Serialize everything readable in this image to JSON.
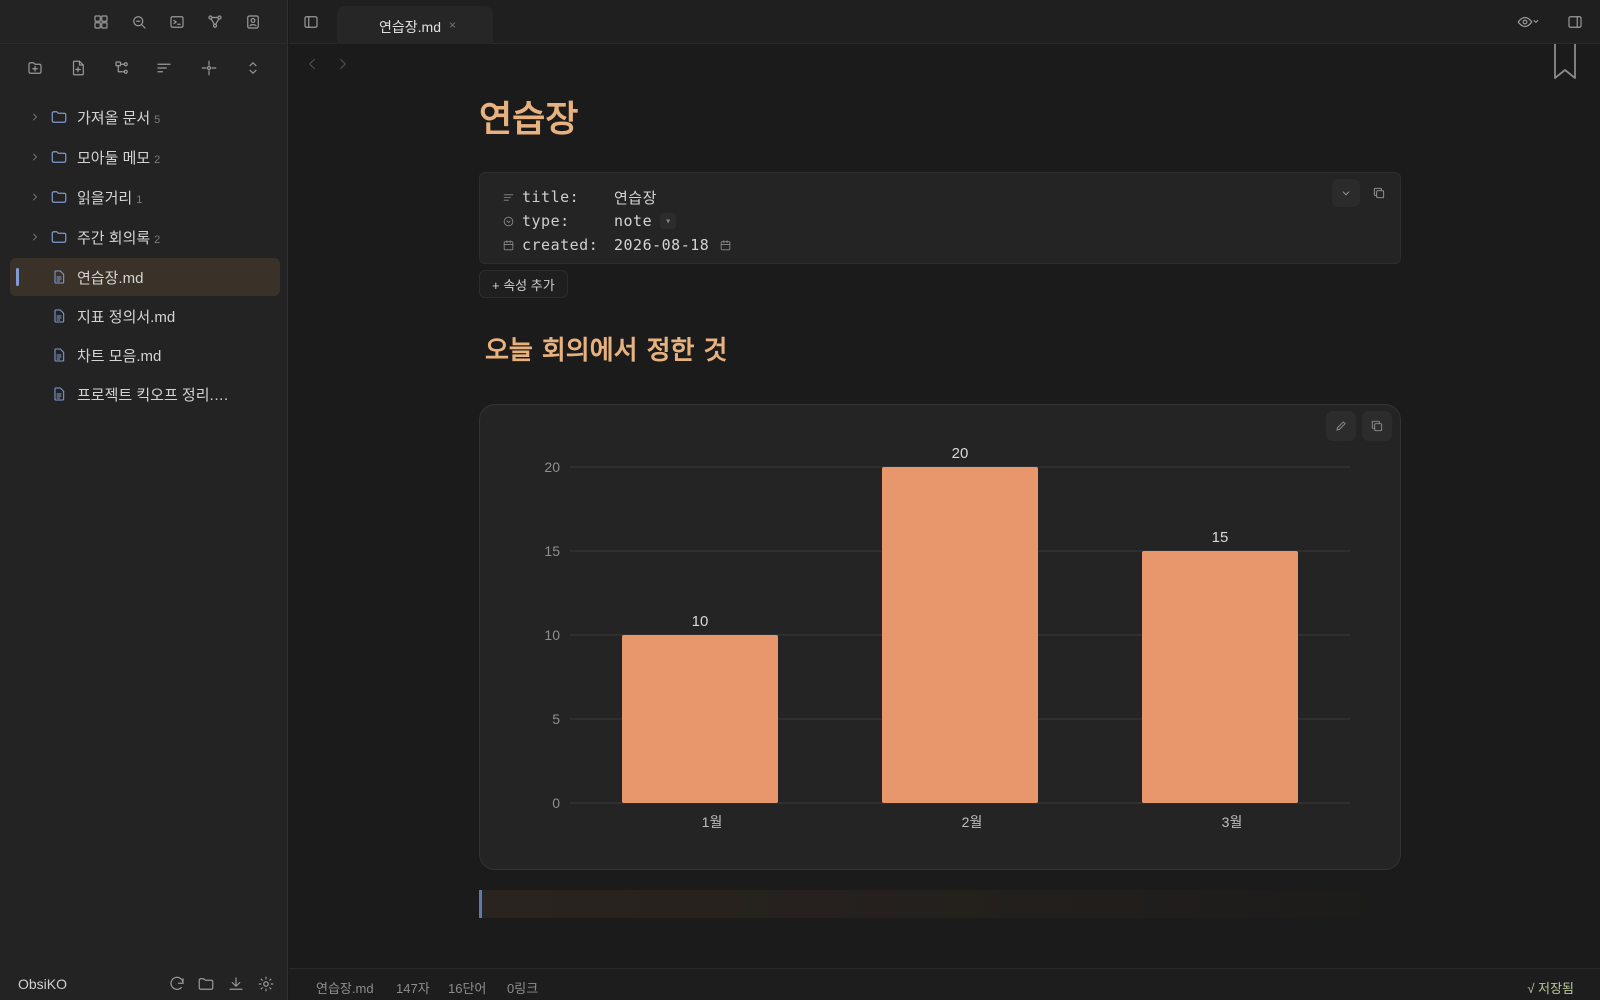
{
  "sidebar": {
    "tree": [
      {
        "type": "folder",
        "label": "가져올 문서",
        "count": "5"
      },
      {
        "type": "folder",
        "label": "모아둘 메모",
        "count": "2"
      },
      {
        "type": "folder",
        "label": "읽을거리",
        "count": "1"
      },
      {
        "type": "folder",
        "label": "주간 회의록",
        "count": "2"
      },
      {
        "type": "file",
        "label": "연습장.md",
        "active": true
      },
      {
        "type": "file",
        "label": "지표 정의서.md"
      },
      {
        "type": "file",
        "label": "차트 모음.md"
      },
      {
        "type": "file",
        "label": "프로젝트 킥오프 정리.…"
      }
    ],
    "vault_name": "ObsiKO"
  },
  "tab": {
    "title": "연습장.md",
    "close": "×"
  },
  "document": {
    "title": "연습장",
    "properties": [
      {
        "icon": "text-lines-icon",
        "key": "title:",
        "value": "연습장"
      },
      {
        "icon": "circle-chevron-icon",
        "key": "type:",
        "value": "note"
      },
      {
        "icon": "calendar-icon",
        "key": "created:",
        "value": "2026-08-18"
      }
    ],
    "add_property_label": "+ 속성 추가",
    "heading": "오늘 회의에서 정한 것"
  },
  "chart_data": {
    "type": "bar",
    "categories": [
      "1월",
      "2월",
      "3월"
    ],
    "values": [
      10,
      20,
      15
    ],
    "ylim": [
      0,
      20
    ],
    "yticks": [
      0,
      5,
      10,
      15,
      20
    ],
    "grid": true,
    "bar_color": "#e8976d"
  },
  "statusbar": {
    "file": "연습장.md",
    "chars": "147자",
    "words": "16단어",
    "links": "0링크",
    "saved": "√ 저장됨"
  },
  "colors": {
    "accent": "#e8b27e",
    "folder_icon": "#7f9cd4",
    "bar": "#e8976d"
  }
}
